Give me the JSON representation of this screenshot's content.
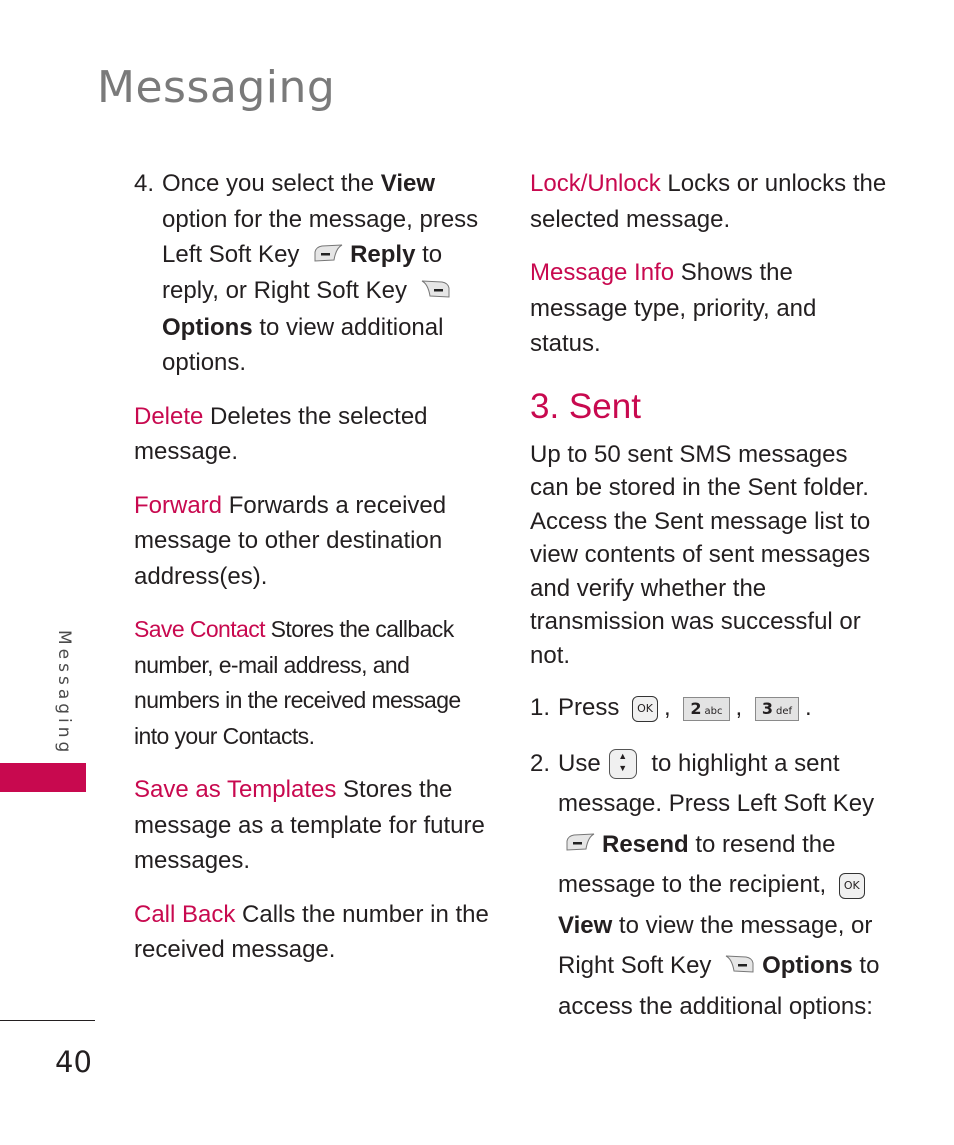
{
  "header": {
    "title": "Messaging"
  },
  "side_tab": {
    "label": "Messaging",
    "accent_color": "#c8094f"
  },
  "footer": {
    "page_number": "40"
  },
  "left_column": {
    "step4": {
      "num": "4.",
      "t1": "Once you select the ",
      "view": "View",
      "t2": " option for the message, press Left Soft Key ",
      "reply": "Reply",
      "t3": " to reply, or Right Soft Key ",
      "options": "Options",
      "t4": " to view additional options."
    },
    "items": [
      {
        "term": "Delete",
        "desc": " Deletes the selected message."
      },
      {
        "term": "Forward",
        "desc": " Forwards a received message to other destination address(es)."
      },
      {
        "term": "Save Contact",
        "desc": " Stores the callback number, e-mail address, and numbers in the received message into your Contacts."
      },
      {
        "term": "Save as Templates",
        "desc": " Stores the message as a template for future messages."
      },
      {
        "term": "Call Back",
        "desc": " Calls the number in the received message."
      }
    ]
  },
  "right_column": {
    "items": [
      {
        "term": "Lock/Unlock",
        "desc": " Locks or unlocks the selected message."
      },
      {
        "term": "Message Info",
        "desc": " Shows the message type, priority, and status."
      }
    ],
    "section_title": "3. Sent",
    "intro": "Up to 50 sent SMS messages can be stored in the Sent folder. Access the Sent message list to view contents of sent messages and verify whether the transmission was successful or not.",
    "step1": {
      "num": "1.",
      "text": "Press",
      "ok": "OK",
      "key2": "2",
      "key2_sub": "abc",
      "key3": "3",
      "key3_sub": "def",
      "sep": ",",
      "end": "."
    },
    "step2": {
      "num": "2.",
      "t1": "Use",
      "t2": " to highlight a sent message. Press Left Soft Key ",
      "resend": "Resend",
      "t3": " to resend the message to the recipient, ",
      "ok": "OK",
      "view": "View",
      "t4": " to view the message, or Right Soft Key ",
      "options": "Options",
      "t5": " to access the additional options:"
    }
  }
}
